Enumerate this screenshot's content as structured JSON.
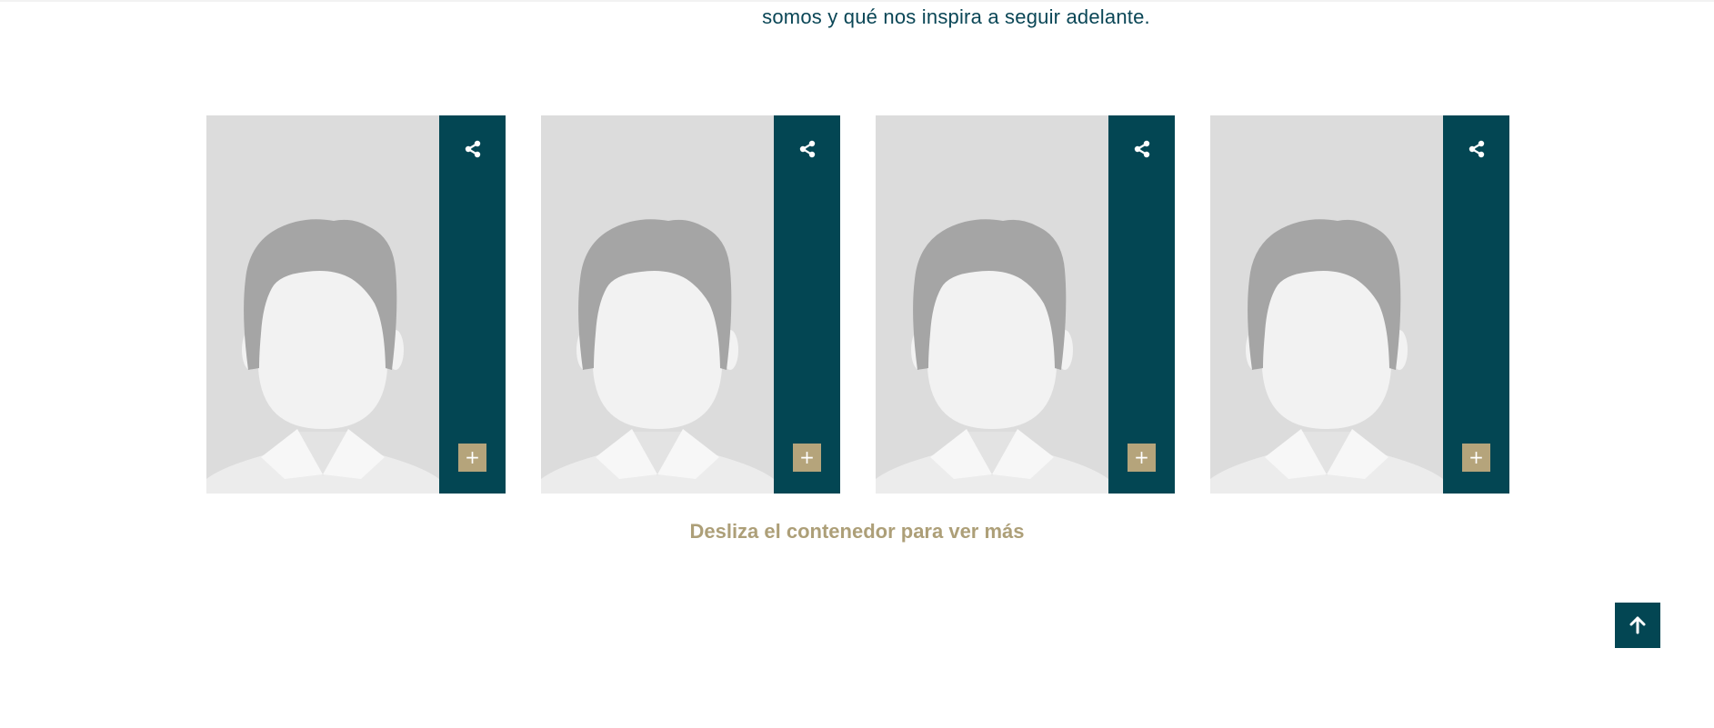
{
  "intro": {
    "text": "somos y qué nos inspira a seguir adelante."
  },
  "cards": [
    {
      "share_icon": "share-icon",
      "more_label": "+"
    },
    {
      "share_icon": "share-icon",
      "more_label": "+"
    },
    {
      "share_icon": "share-icon",
      "more_label": "+"
    },
    {
      "share_icon": "share-icon",
      "more_label": "+"
    }
  ],
  "hint": {
    "text": "Desliza el contenedor para ver más"
  },
  "scroll_top": {
    "icon": "arrow-up-icon"
  },
  "colors": {
    "primary": "#034653",
    "accent": "#b5a47b",
    "hint": "#ad9f78",
    "photo_bg": "#dcdcdc"
  }
}
